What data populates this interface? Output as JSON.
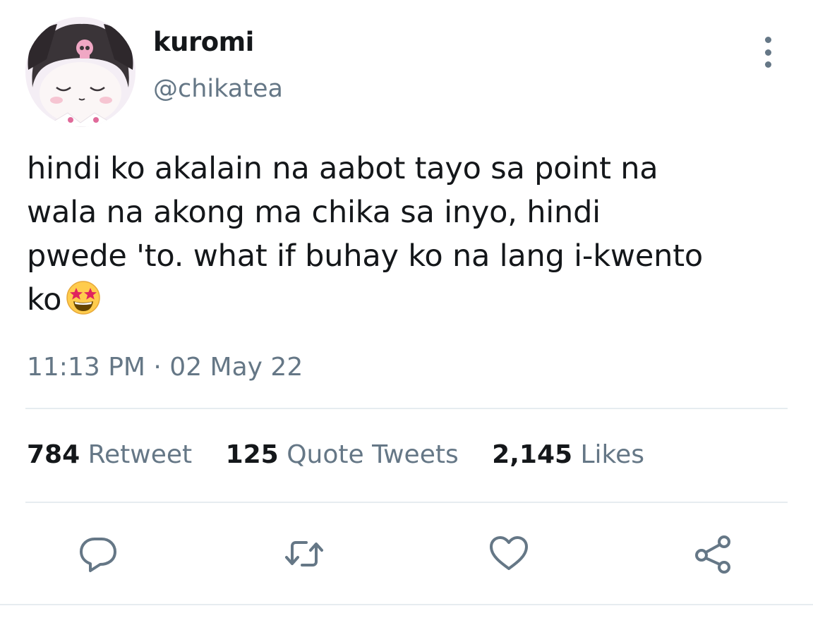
{
  "author": {
    "display_name": "kuromi",
    "handle": "@chikatea",
    "avatar_icon": "kuromi-avatar"
  },
  "tweet": {
    "text_lines": [
      "hindi ko akalain na aabot tayo sa point na",
      "wala na akong ma chika sa inyo, hindi",
      "pwede 'to. what if buhay ko na lang i-kwento",
      "ko"
    ],
    "emoji": "star-struck-emoji",
    "timestamp": "11:13 PM · 02 May 22"
  },
  "stats": {
    "retweets": {
      "count": "784",
      "label": "Retweet"
    },
    "quotes": {
      "count": "125",
      "label": "Quote Tweets"
    },
    "likes": {
      "count": "2,145",
      "label": "Likes"
    }
  },
  "actions": [
    "reply-icon",
    "retweet-icon",
    "like-icon",
    "share-icon"
  ],
  "colors": {
    "text": "#14171a",
    "secondary": "#657786",
    "divider": "#e6ecf0"
  }
}
